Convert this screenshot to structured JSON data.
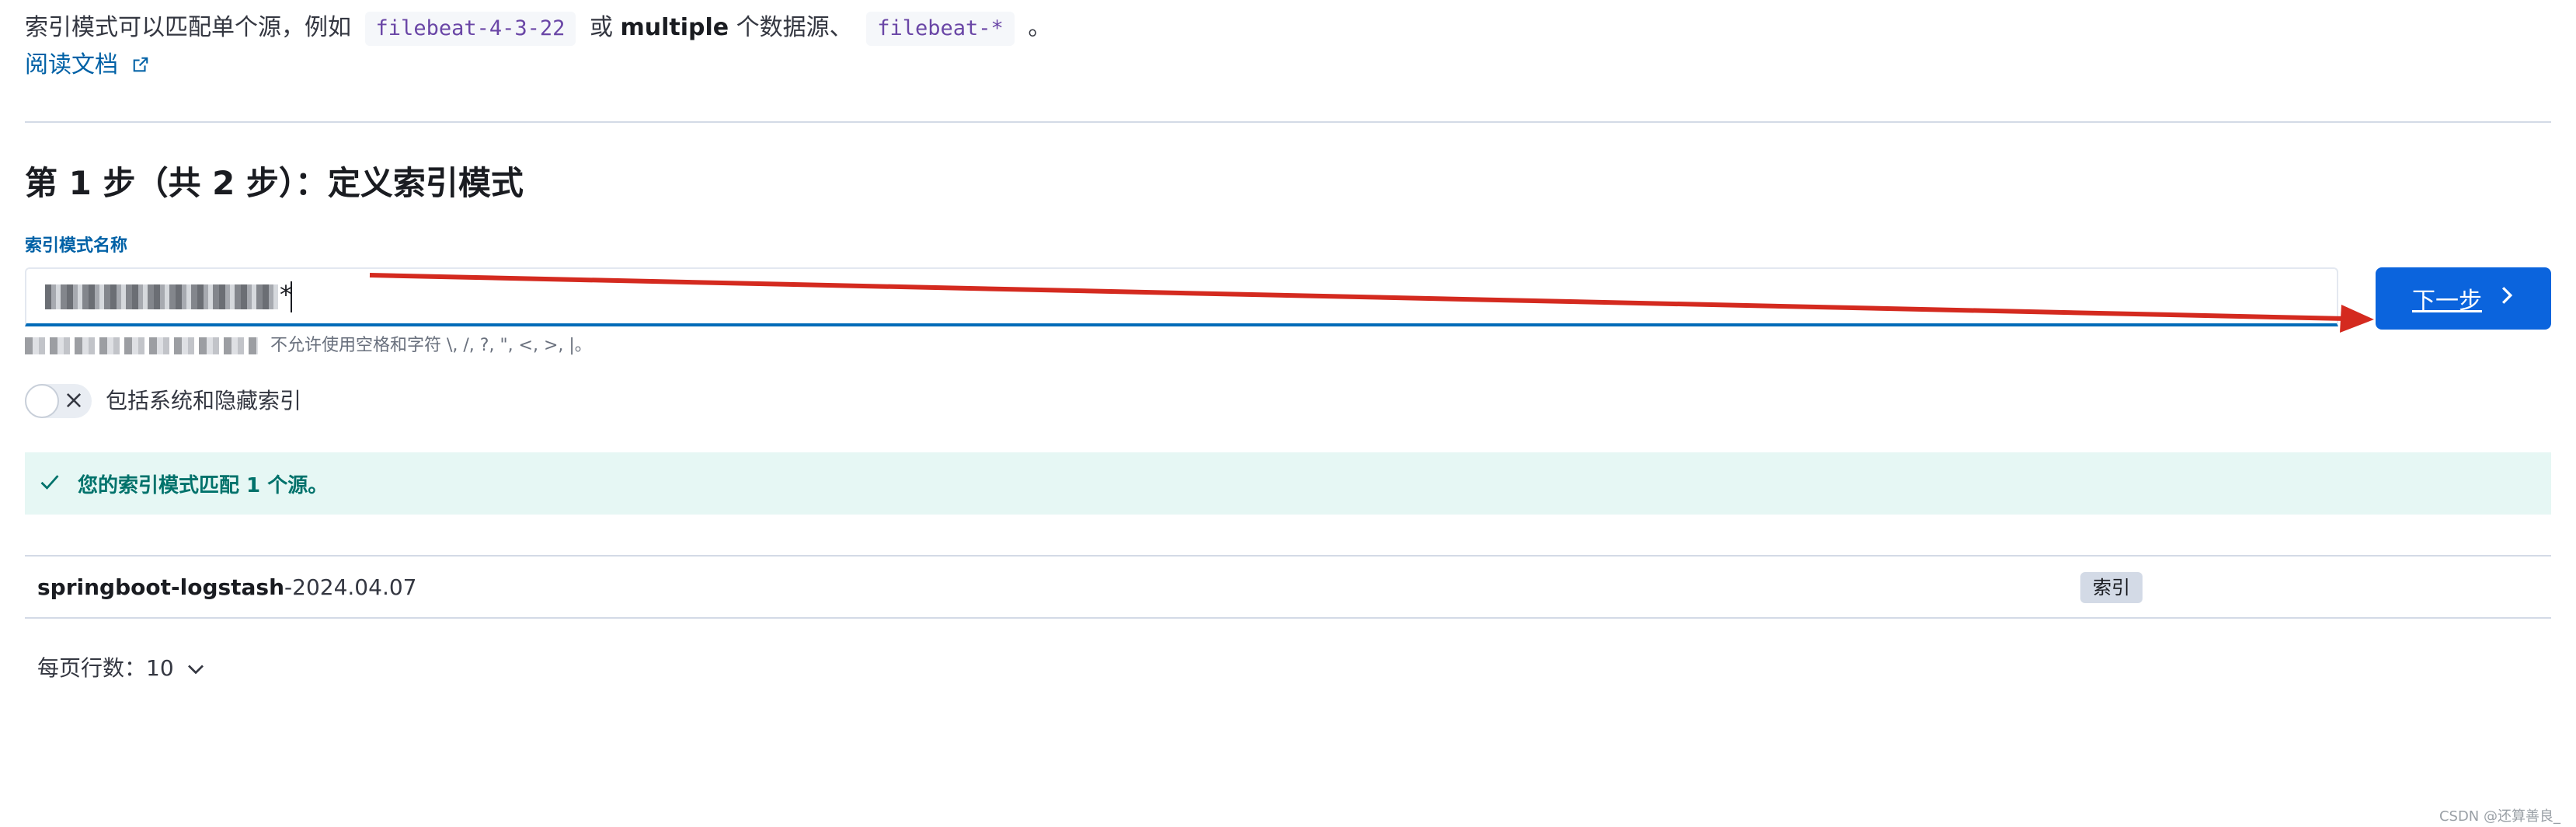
{
  "intro": {
    "prefix": "索引模式可以匹配单个源，例如",
    "code1": "filebeat-4-3-22",
    "middle": "或",
    "bold": "multiple",
    "suffix": "个数据源、",
    "code2": "filebeat-*",
    "end": "。"
  },
  "doc_link": {
    "label": "阅读文档",
    "icon": "external-link-icon"
  },
  "step_title": "第 1 步（共 2 步）：定义索引模式",
  "field": {
    "label": "索引模式名称",
    "typed_suffix": "*",
    "help_text": "不允许使用空格和字符 \\, /, ?, \", <, >, |。"
  },
  "next_button": {
    "label": "下一步",
    "icon": "chevron-right-icon",
    "color": "#0b64dd"
  },
  "toggle": {
    "label": "包括系统和隐藏索引",
    "checked": false,
    "icon": "cross-icon"
  },
  "callout": {
    "text": "您的索引模式匹配 1 个源。",
    "icon": "check-icon",
    "color": "#00726b"
  },
  "results": [
    {
      "name_bold": "springboot-logstash",
      "name_rest": "-2024.04.07",
      "badge": "索引"
    }
  ],
  "pagination": {
    "label": "每页行数：10",
    "icon": "chevron-down-icon"
  },
  "annotation": {
    "color": "#d42a1f",
    "icon": "arrow-annotation"
  },
  "watermark": "CSDN @还算善良_"
}
